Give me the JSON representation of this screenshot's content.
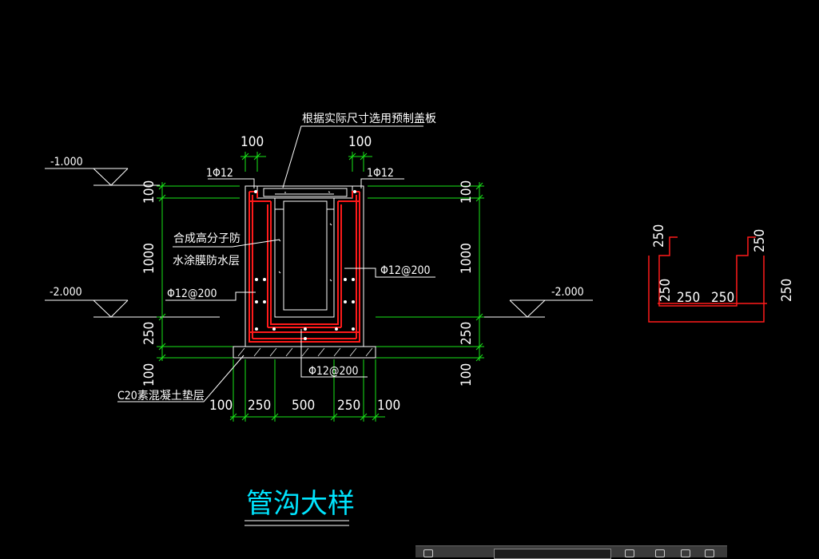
{
  "drawing": {
    "title": "管沟大样",
    "levels": {
      "left_top": "-1.000",
      "left_mid": "-2.000",
      "right_mid": "-2.000"
    },
    "notes": {
      "cover": "根据实际尺寸选用预制盖板",
      "waterproof_line1": "合成高分子防",
      "waterproof_line2": "水涂膜防水层",
      "cushion": "C20素混凝土垫层"
    },
    "rebar": {
      "top_left": "1Φ12",
      "top_right": "1Φ12",
      "left_wall": "Φ12@200",
      "right_wall": "Φ12@200",
      "bottom": "Φ12@200"
    },
    "dims": {
      "top_left_width": "100",
      "top_right_width": "100",
      "left_v1": "100",
      "left_v2": "1000",
      "left_v3": "250",
      "left_v4": "100",
      "right_v1": "100",
      "right_v2": "1000",
      "right_v3": "250",
      "right_v4": "100",
      "bottom": [
        "100",
        "250",
        "500",
        "250",
        "100"
      ]
    },
    "detail_dims": {
      "left_leg": "250",
      "right_leg": "250",
      "bottom_left": "250",
      "bottom_mid1": "250",
      "bottom_mid2": "250",
      "right_height": "250"
    },
    "colors": {
      "background": "#000000",
      "rebar": "#ff1a1a",
      "dimension": "#19e619",
      "text": "#ffffff",
      "title": "#00e5ff"
    }
  }
}
